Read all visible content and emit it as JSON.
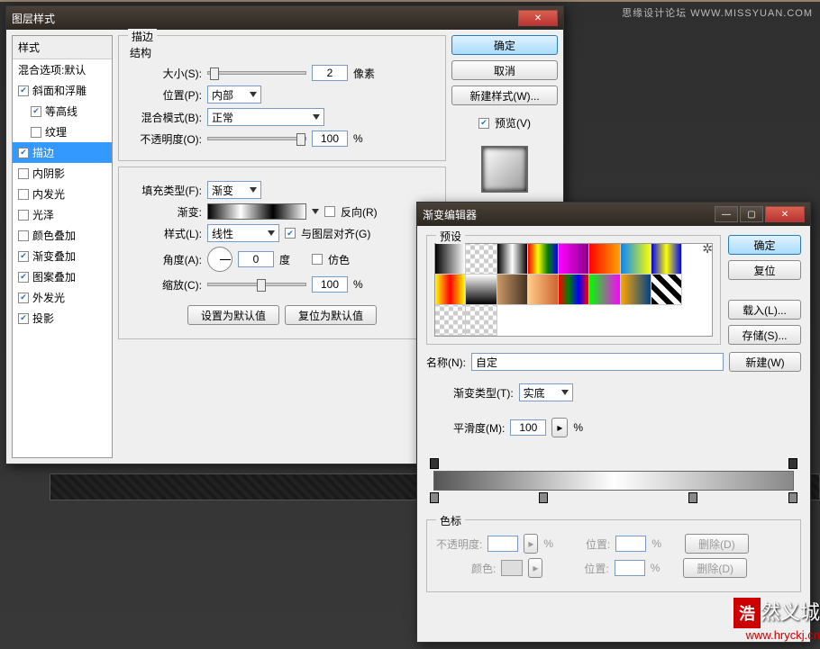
{
  "watermark_top": "思缘设计论坛  WWW.MISSYUAN.COM",
  "watermark_logo": "浩",
  "watermark_text": "然义城",
  "watermark_url": "www.hryckj.cn",
  "layerStyle": {
    "title": "图层样式",
    "sidebar": {
      "header": "样式",
      "blend": "混合选项:默认",
      "items": [
        {
          "label": "斜面和浮雕",
          "checked": true,
          "sub": false
        },
        {
          "label": "等高线",
          "checked": true,
          "sub": true
        },
        {
          "label": "纹理",
          "checked": false,
          "sub": true
        },
        {
          "label": "描边",
          "checked": true,
          "sub": false,
          "selected": true
        },
        {
          "label": "内阴影",
          "checked": false,
          "sub": false
        },
        {
          "label": "内发光",
          "checked": false,
          "sub": false
        },
        {
          "label": "光泽",
          "checked": false,
          "sub": false
        },
        {
          "label": "颜色叠加",
          "checked": false,
          "sub": false
        },
        {
          "label": "渐变叠加",
          "checked": true,
          "sub": false
        },
        {
          "label": "图案叠加",
          "checked": true,
          "sub": false
        },
        {
          "label": "外发光",
          "checked": true,
          "sub": false
        },
        {
          "label": "投影",
          "checked": true,
          "sub": false
        }
      ]
    },
    "stroke": {
      "group_title": "描边",
      "structure": "结构",
      "size_label": "大小(S):",
      "size_value": "2",
      "size_unit": "像素",
      "position_label": "位置(P):",
      "position_value": "内部",
      "blend_label": "混合模式(B):",
      "blend_value": "正常",
      "opacity_label": "不透明度(O):",
      "opacity_value": "100",
      "opacity_unit": "%",
      "fill_label": "填充类型(F):",
      "fill_value": "渐变",
      "gradient_label": "渐变:",
      "reverse_label": "反向(R)",
      "style_label": "样式(L):",
      "style_value": "线性",
      "align_label": "与图层对齐(G)",
      "angle_label": "角度(A):",
      "angle_value": "0",
      "angle_unit": "度",
      "dither_label": "仿色",
      "scale_label": "缩放(C):",
      "scale_value": "100",
      "scale_unit": "%",
      "default_btn": "设置为默认值",
      "reset_btn": "复位为默认值"
    },
    "buttons": {
      "ok": "确定",
      "cancel": "取消",
      "new_style": "新建样式(W)...",
      "preview": "预览(V)"
    }
  },
  "gradEditor": {
    "title": "渐变编辑器",
    "presets_label": "预设",
    "buttons": {
      "ok": "确定",
      "reset": "复位",
      "load": "载入(L)...",
      "save": "存储(S)..."
    },
    "name_label": "名称(N):",
    "name_value": "自定",
    "new_btn": "新建(W)",
    "type_label": "渐变类型(T):",
    "type_value": "实底",
    "smooth_label": "平滑度(M):",
    "smooth_value": "100",
    "smooth_unit": "%",
    "stops": {
      "group": "色标",
      "opacity_label": "不透明度:",
      "opacity_unit": "%",
      "position_label": "位置:",
      "position_unit": "%",
      "color_label": "颜色:",
      "delete": "删除(D)"
    },
    "swatches": [
      "linear-gradient(to right,#000,#fff)",
      "repeating-conic-gradient(#ccc 0 25%,#fff 0 50%) 0/10px 10px",
      "linear-gradient(to right,#000,#fff,#000)",
      "linear-gradient(to right,red,yellow,green,blue)",
      "linear-gradient(to right,#f0f,#808)",
      "linear-gradient(to right,red,orange)",
      "linear-gradient(to right,#08f,#ff0)",
      "linear-gradient(to right,#00f,#ff0,#00f)",
      "linear-gradient(to right,yellow,red,yellow)",
      "linear-gradient(to bottom,#fff,#000)",
      "linear-gradient(to right,#c96,#432)",
      "linear-gradient(to right,#fc8,#c63)",
      "linear-gradient(to right,red,green,blue,red)",
      "linear-gradient(to right,#0f0,#f0f)",
      "linear-gradient(to right,orange,#048)",
      "repeating-linear-gradient(45deg,#000 0 6px,#fff 6px 12px)",
      "repeating-conic-gradient(#ccc 0 25%,#fff 0 50%) 0/10px 10px",
      "repeating-conic-gradient(#ccc 0 25%,#fff 0 50%) 0/10px 10px"
    ]
  }
}
